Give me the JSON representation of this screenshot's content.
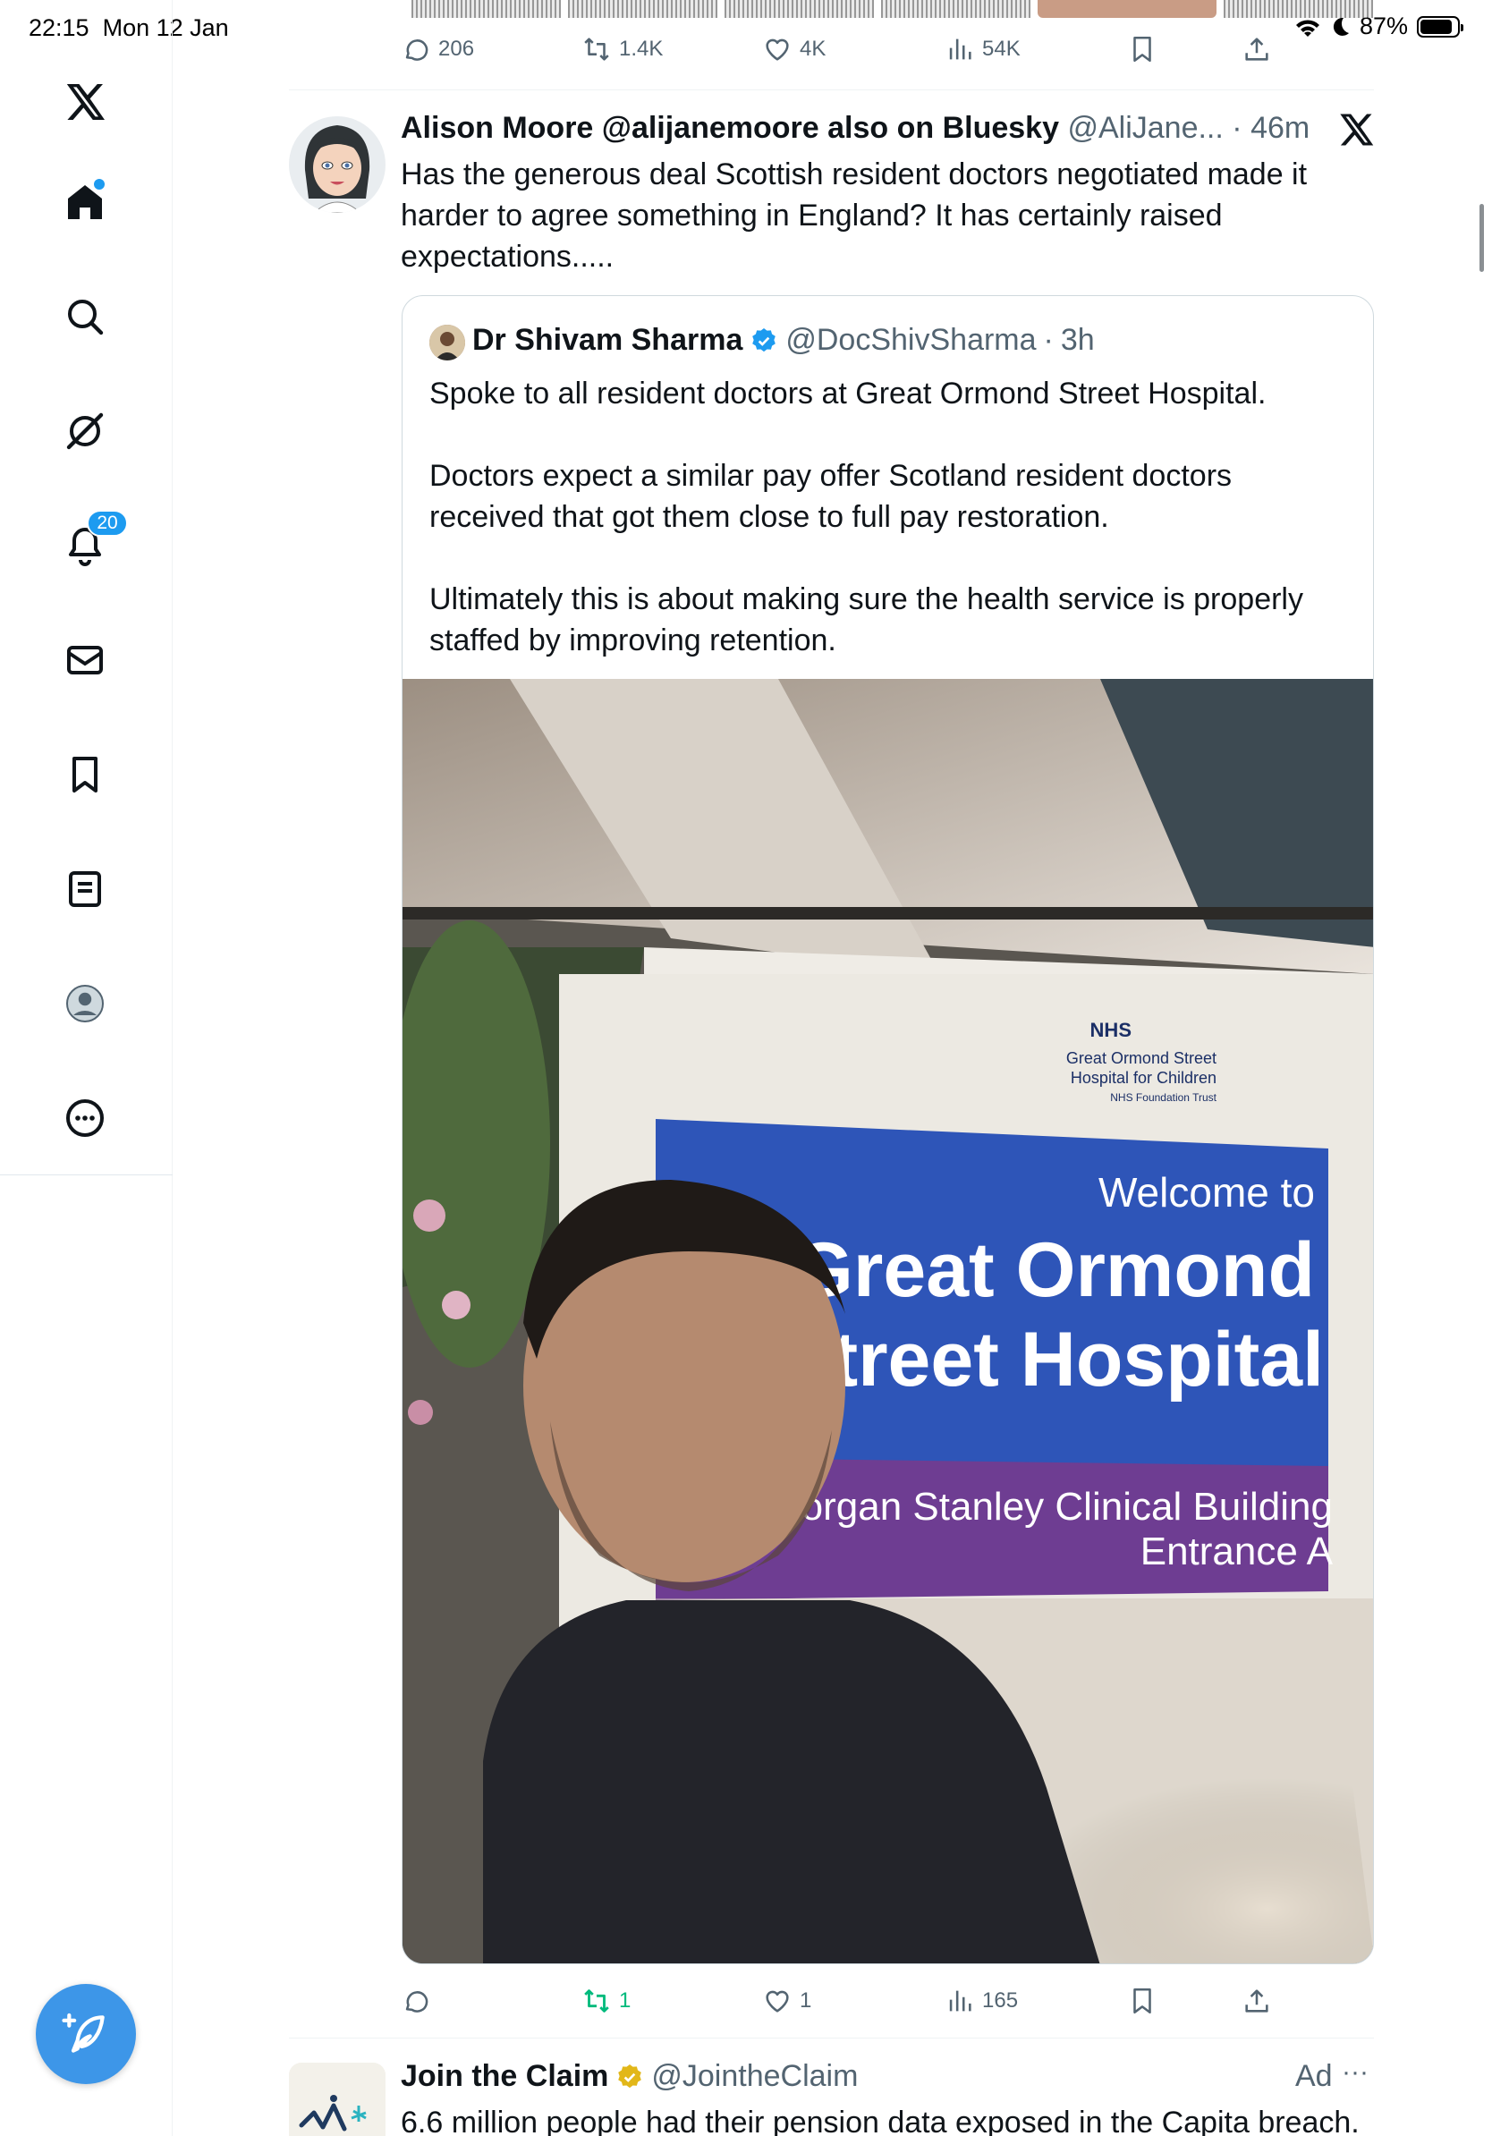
{
  "status_bar": {
    "time": "22:15",
    "date": "Mon 12 Jan",
    "battery": "87%",
    "battery_level": 0.87
  },
  "sidebar": {
    "items": [
      {
        "name": "x-logo",
        "icon": "x-logo-icon"
      },
      {
        "name": "home",
        "icon": "home-icon"
      },
      {
        "name": "explore",
        "icon": "search-icon"
      },
      {
        "name": "grok",
        "icon": "grok-icon"
      },
      {
        "name": "notifications",
        "icon": "bell-icon",
        "badge": "20"
      },
      {
        "name": "messages",
        "icon": "envelope-icon"
      },
      {
        "name": "bookmarks",
        "icon": "bookmark-icon"
      },
      {
        "name": "lists",
        "icon": "list-icon"
      },
      {
        "name": "profile",
        "icon": "profile-icon"
      },
      {
        "name": "more",
        "icon": "more-circle-icon"
      }
    ],
    "compose": {
      "icon": "compose-feather-icon"
    }
  },
  "prev_tweet_actions": {
    "replies": "206",
    "reposts": "1.4K",
    "likes": "4K",
    "views": "54K"
  },
  "tweet": {
    "author_name": "Alison Moore @alijanemoore also on Bluesky",
    "author_handle": "@AliJane...",
    "separator": "·",
    "time": "46m",
    "text": "Has the generous deal Scottish resident doctors negotiated made it harder to agree something in England? It has certainly raised expectations.....",
    "quote": {
      "author_name": "Dr Shivam Sharma",
      "verified": true,
      "author_handle": "@DocShivSharma",
      "separator": "·",
      "time": "3h",
      "text": "Spoke to all resident doctors at Great Ormond Street Hospital.\n\nDoctors expect a similar pay offer Scotland resident doctors received that got them close to full pay restoration.\n\nUltimately this is about making sure the health service is properly staffed by improving retention.",
      "photo": {
        "sign_nhs": "NHS",
        "sign_org_1": "Great Ormond Street",
        "sign_org_2": "Hospital for Children",
        "sign_org_3": "NHS Foundation Trust",
        "sign_welcome": "Welcome to",
        "sign_name_1": "Great Ormond",
        "sign_name_2": "Street Hospital",
        "sign_building_1": "Morgan Stanley Clinical Building",
        "sign_building_2": "Entrance A"
      }
    },
    "actions": {
      "replies": "",
      "reposts": "1",
      "likes": "1",
      "views": "165"
    }
  },
  "ad": {
    "author_name": "Join the Claim",
    "author_handle": "@JointheClaim",
    "label": "Ad",
    "more": "···",
    "text": "6.6 million people had their pension data exposed in the Capita breach."
  },
  "colors": {
    "accent": "#1d9bf0",
    "repost_active": "#00ba7c",
    "muted": "#536471",
    "compose": "#3d96e8"
  }
}
